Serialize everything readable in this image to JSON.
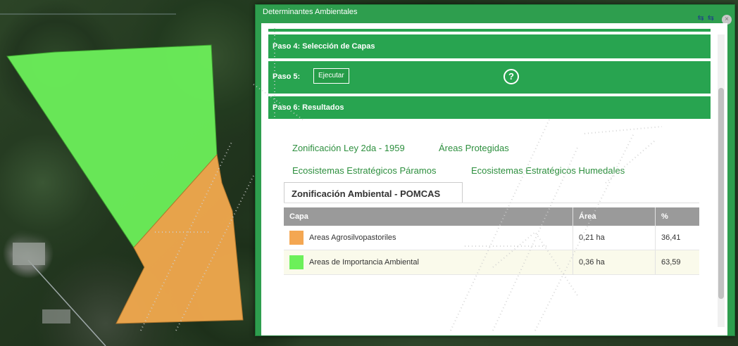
{
  "panel": {
    "title": "Determinantes Ambientales",
    "tools": "⇆ ⇆",
    "close": "×"
  },
  "steps": {
    "step4": "Paso 4: Selección de Capas",
    "step5": "Paso 5:",
    "execute_button": "Ejecutar",
    "help": "?",
    "step6": "Paso 6: Resultados"
  },
  "tabs": [
    "Zonificación Ley 2da - 1959",
    "Áreas Protegidas",
    "Ecosistemas Estratégicos Páramos",
    "Ecosistemas Estratégicos Humedales"
  ],
  "active_tab": "Zonificación Ambiental - POMCAS",
  "table": {
    "headers": [
      "Capa",
      "Área",
      "%"
    ],
    "rows": [
      {
        "color": "#f4a752",
        "capa": "Areas Agrosilvopastoriles",
        "area": "0,21 ha",
        "pct": "36,41"
      },
      {
        "color": "#6cf05a",
        "capa": "Areas de Importancia Ambiental",
        "area": "0,36 ha",
        "pct": "63,59"
      }
    ]
  },
  "map_colors": {
    "green_polygon": "#6cf05a",
    "orange_polygon": "#f2a94e"
  }
}
